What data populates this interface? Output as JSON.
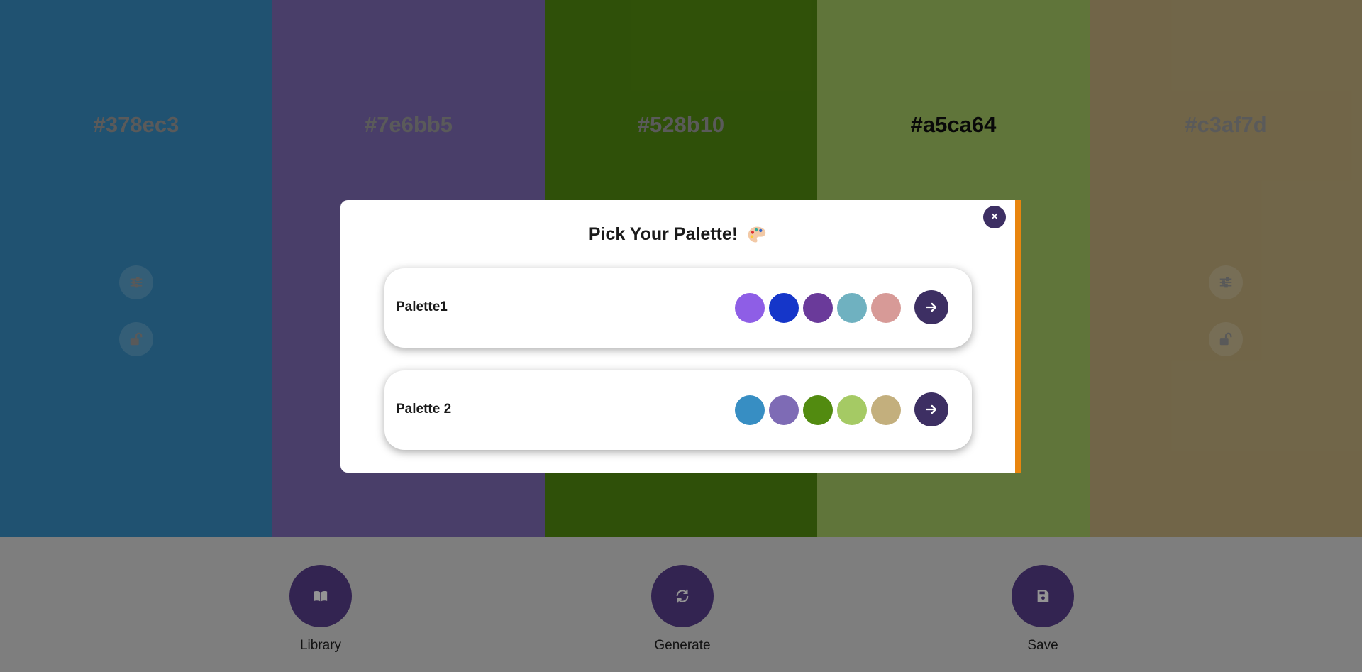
{
  "colors": [
    {
      "hex": "#378ec3",
      "text_color": "#9c9c9c",
      "show_controls": true
    },
    {
      "hex": "#7e6bb5",
      "text_color": "#9c9c9c",
      "show_controls": false
    },
    {
      "hex": "#528b10",
      "text_color": "#9c9c9c",
      "show_controls": false
    },
    {
      "hex": "#a5ca64",
      "text_color": "#111111",
      "show_controls": false
    },
    {
      "hex": "#c3af7d",
      "text_color": "#9c9c9c",
      "show_controls": true
    }
  ],
  "controls": {
    "adjust_icon": "sliders-icon",
    "lock_icon": "unlock-icon"
  },
  "bottom_bar": {
    "library_label": "Library",
    "generate_label": "Generate",
    "save_label": "Save"
  },
  "modal": {
    "title": "Pick Your Palette!",
    "close_label": "×",
    "palettes": [
      {
        "name": "Palette1",
        "swatches": [
          "#8e5ee6",
          "#1536c9",
          "#6a3a9a",
          "#6fb1c0",
          "#d79a97"
        ]
      },
      {
        "name": "Palette 2",
        "swatches": [
          "#378ec3",
          "#7e6bb5",
          "#528b10",
          "#a5ca64",
          "#c3af7d"
        ]
      }
    ]
  },
  "accent": "#3d2f63",
  "modal_accent": "#e9850e"
}
